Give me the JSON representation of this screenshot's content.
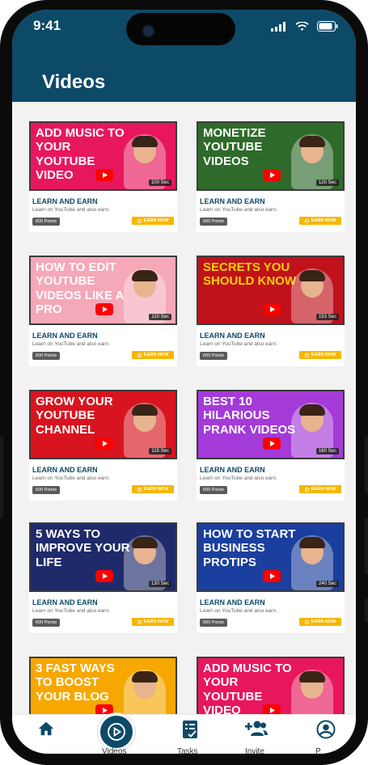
{
  "status_bar": {
    "time": "9:41"
  },
  "header": {
    "title": "Videos"
  },
  "cards": [
    {
      "thumb_text": "Add Music to Your YouTube Video",
      "duration": "100 Sec",
      "title": "LEARN AND EARN",
      "desc": "Learn on YouTube and also earn.",
      "points": "600 Points",
      "earn": "EARN NOW",
      "bg": "#e8175d",
      "fg": "#ffffff"
    },
    {
      "thumb_text": "Monetize YouTube Videos",
      "duration": "120 Sec",
      "title": "LEARN AND EARN",
      "desc": "Learn on YouTube and also earn.",
      "points": "600 Points",
      "earn": "EARN NOW",
      "bg": "#2e6b2a",
      "fg": "#ffffff"
    },
    {
      "thumb_text": "How to Edit Youtube Videos Like a Pro",
      "duration": "110 Sec",
      "title": "LEARN AND EARN",
      "desc": "Learn on YouTube and also earn.",
      "points": "600 Points",
      "earn": "EARN NOW",
      "bg": "#f4a8b8",
      "fg": "#ffffff"
    },
    {
      "thumb_text": "Secrets You Should Know",
      "duration": "153 Sec",
      "title": "LEARN AND EARN",
      "desc": "Learn on YouTube and also earn.",
      "points": "600 Points",
      "earn": "EARN NOW",
      "bg": "#c0121c",
      "fg": "#f5d000"
    },
    {
      "thumb_text": "Grow Your YouTube Channel",
      "duration": "115 Sec",
      "title": "LEARN AND EARN",
      "desc": "Learn on YouTube and also earn.",
      "points": "600 Points",
      "earn": "EARN NOW",
      "bg": "#d7141f",
      "fg": "#ffffff"
    },
    {
      "thumb_text": "Best 10 Hilarious Prank Videos",
      "duration": "160 Sec",
      "title": "LEARN AND EARN",
      "desc": "Learn on YouTube and also earn.",
      "points": "600 Points",
      "earn": "EARN NOW",
      "bg": "#a43ad8",
      "fg": "#ffffff"
    },
    {
      "thumb_text": "5 Ways to Improve Your Life",
      "duration": "130 Sec",
      "title": "LEARN AND EARN",
      "desc": "Learn on YouTube and also earn.",
      "points": "600 Points",
      "earn": "EARN NOW",
      "bg": "#1f2a6b",
      "fg": "#ffffff"
    },
    {
      "thumb_text": "How to Start Business ProTips",
      "duration": "240 Sec",
      "title": "LEARN AND EARN",
      "desc": "Learn on YouTube and also earn.",
      "points": "600 Points",
      "earn": "EARN NOW",
      "bg": "#1b3f9e",
      "fg": "#ffffff"
    },
    {
      "thumb_text": "3 Fast Ways to Boost Your Blog",
      "duration": "",
      "title": "",
      "desc": "",
      "points": "",
      "earn": "",
      "bg": "#f6a800",
      "fg": "#ffffff"
    },
    {
      "thumb_text": "Add Music to Your YouTube Video",
      "duration": "",
      "title": "",
      "desc": "",
      "points": "",
      "earn": "",
      "bg": "#e8175d",
      "fg": "#ffffff"
    }
  ],
  "nav": {
    "items": [
      {
        "icon": "home-icon",
        "label": ""
      },
      {
        "icon": "play-circle-icon",
        "label": "Videos"
      },
      {
        "icon": "tasks-icon",
        "label": "Tasks"
      },
      {
        "icon": "invite-icon",
        "label": "Invite"
      },
      {
        "icon": "profile-icon",
        "label": "P"
      }
    ]
  },
  "colors": {
    "primary": "#0d4a68",
    "accent": "#f5b700",
    "background": "#f2f2f2"
  }
}
